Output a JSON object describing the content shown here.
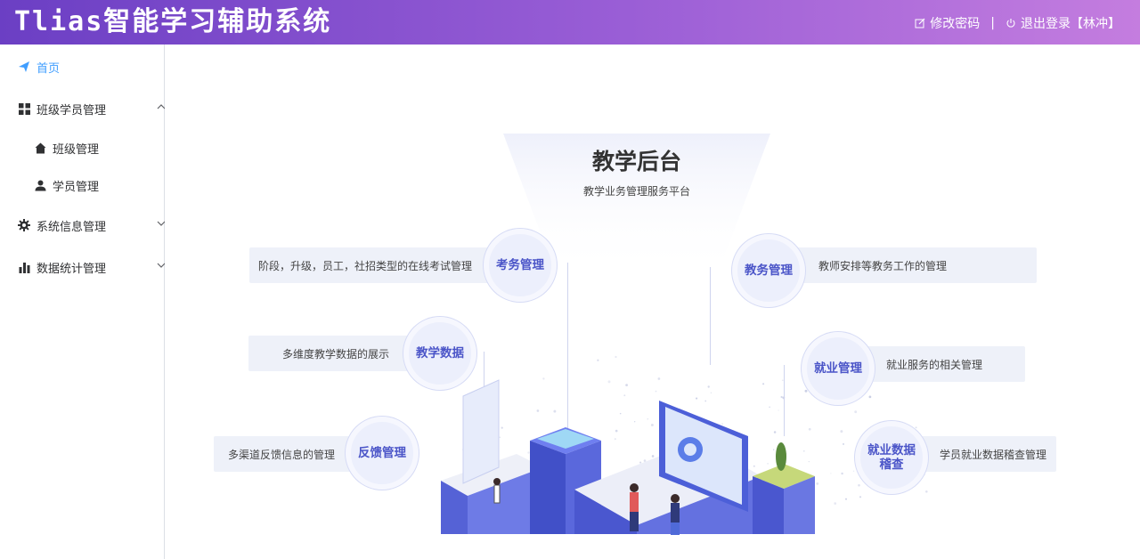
{
  "header": {
    "app_title": "Tlias智能学习辅助系统",
    "change_password": "修改密码",
    "separator": "|",
    "logout": "退出登录【林冲】"
  },
  "sidebar": {
    "home": "首页",
    "class_student": "班级学员管理",
    "class_manage": "班级管理",
    "student_manage": "学员管理",
    "system_info": "系统信息管理",
    "data_stats": "数据统计管理"
  },
  "main": {
    "title": "教学后台",
    "subtitle": "教学业务管理服务平台",
    "features": {
      "exam": {
        "name": "考务管理",
        "desc": "阶段，升级，员工，社招类型的在线考试管理"
      },
      "academic": {
        "name": "教务管理",
        "desc": "教师安排等教务工作的管理"
      },
      "teaching_data": {
        "name": "教学数据",
        "desc": "多维度教学数据的展示"
      },
      "employment": {
        "name": "就业管理",
        "desc": "就业服务的相关管理"
      },
      "feedback": {
        "name": "反馈管理",
        "desc": "多渠道反馈信息的管理"
      },
      "emp_data": {
        "name_line1": "就业数据",
        "name_line2": "稽查",
        "desc": "学员就业数据稽查管理"
      }
    }
  },
  "colors": {
    "header_start": "#6b3fc4",
    "header_end": "#c47ddf",
    "active_menu": "#409eff",
    "feature_text": "#4b55c8"
  }
}
